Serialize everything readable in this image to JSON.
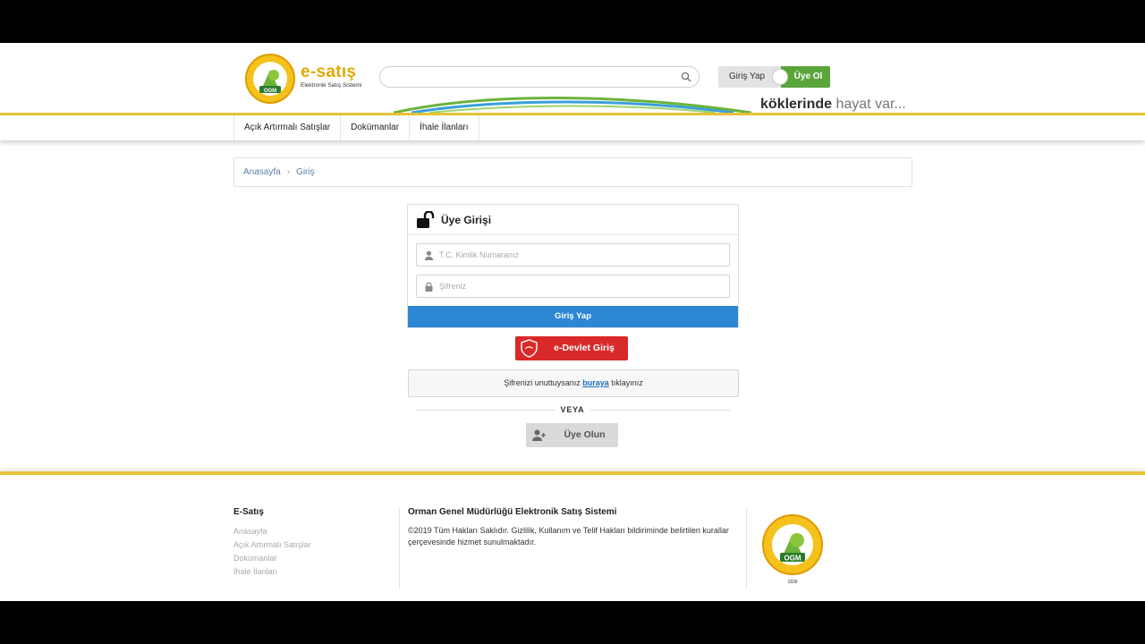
{
  "header": {
    "logo_name": "e-satış",
    "logo_subtitle": "Elektronik Satış Sistemi",
    "logo_ring_text": "ORMAN GENEL MÜDÜRLÜĞÜ",
    "logo_badge": "OGM",
    "search_placeholder": "",
    "login_label": "Giriş Yap",
    "register_label": "Üye Ol",
    "slogan_bold": "köklerinde",
    "slogan_light": "hayat var...",
    "icons": [
      "search-icon"
    ]
  },
  "nav": {
    "items": [
      "Açık Artırmalı Satışlar",
      "Dokümanlar",
      "İhale İlanları"
    ]
  },
  "breadcrumb": {
    "items": [
      "Anasayfa",
      "Giriş"
    ]
  },
  "login": {
    "title": "Üye Girişi",
    "tc_placeholder": "T.C. Kimlik Numaranız",
    "password_placeholder": "Şifreniz",
    "submit_label": "Giriş Yap",
    "edevlet_label": "e-Devlet Giriş",
    "forgot_prefix": "Şifrenizi unuttuysanız",
    "forgot_link": "buraya",
    "forgot_suffix": "tıklayınız",
    "or_label": "VEYA",
    "signup_label": "Üye Olun"
  },
  "footer": {
    "col1_title": "E-Satış",
    "links": [
      "Anasayfa",
      "Açık Artırmalı Satışlar",
      "Dokümanlar",
      "İhale İlanları"
    ],
    "col2_title": "Orman Genel Müdürlüğü Elektronik Satış Sistemi",
    "col2_text": "©2019 Tüm Hakları Saklıdır. Gizlilik, Kullanım ve Telif Hakları bildiriminde belirtilen kurallar çerçevesinde hizmet sunulmaktadır.",
    "logo_ring_text": "ORMAN GENEL MÜDÜRLÜĞÜ",
    "logo_badge": "OGM",
    "logo_year": "1839"
  },
  "colors": {
    "gold": "#e6c338",
    "green": "#5aa53a",
    "blue": "#2d87d4",
    "red": "#d82a29"
  }
}
